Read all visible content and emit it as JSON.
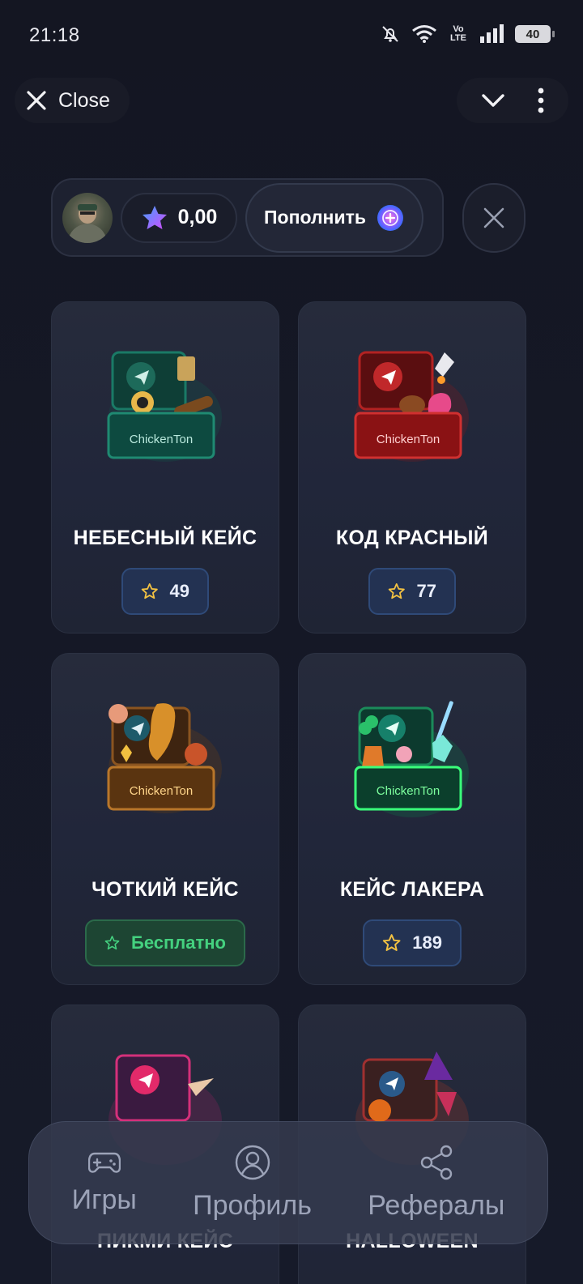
{
  "status_bar": {
    "time": "21:18",
    "network": "Vo LTE",
    "battery": "40"
  },
  "telegram_bar": {
    "close_label": "Close"
  },
  "wallet": {
    "balance": "0,00",
    "topup_label": "Пополнить"
  },
  "cases": [
    {
      "name": "НЕБЕСНЫЙ КЕЙС",
      "price": "49",
      "free": false,
      "brand": "ChickenTon",
      "color": "#0f5a4a"
    },
    {
      "name": "КОД КРАСНЫЙ",
      "price": "77",
      "free": false,
      "brand": "ChickenTon",
      "color": "#9a1818"
    },
    {
      "name": "ЧОТКИЙ КЕЙС",
      "price": "Бесплатно",
      "free": true,
      "brand": "ChickenTon",
      "color": "#6a3e12"
    },
    {
      "name": "КЕЙС ЛАКЕРА",
      "price": "189",
      "free": false,
      "brand": "ChickenTon",
      "color": "#0c5a3c"
    },
    {
      "name": "ПИКМИ КЕЙС",
      "color": "#3a1a40"
    },
    {
      "name": "HALLOWEEN",
      "color": "#3a2020"
    }
  ],
  "bottom_nav": {
    "games": "Игры",
    "profile": "Профиль",
    "referrals": "Рефералы"
  },
  "colors": {
    "accent_blue": "#2f4a78",
    "free_green": "#44d17f",
    "star_gold": "#f3c242"
  }
}
